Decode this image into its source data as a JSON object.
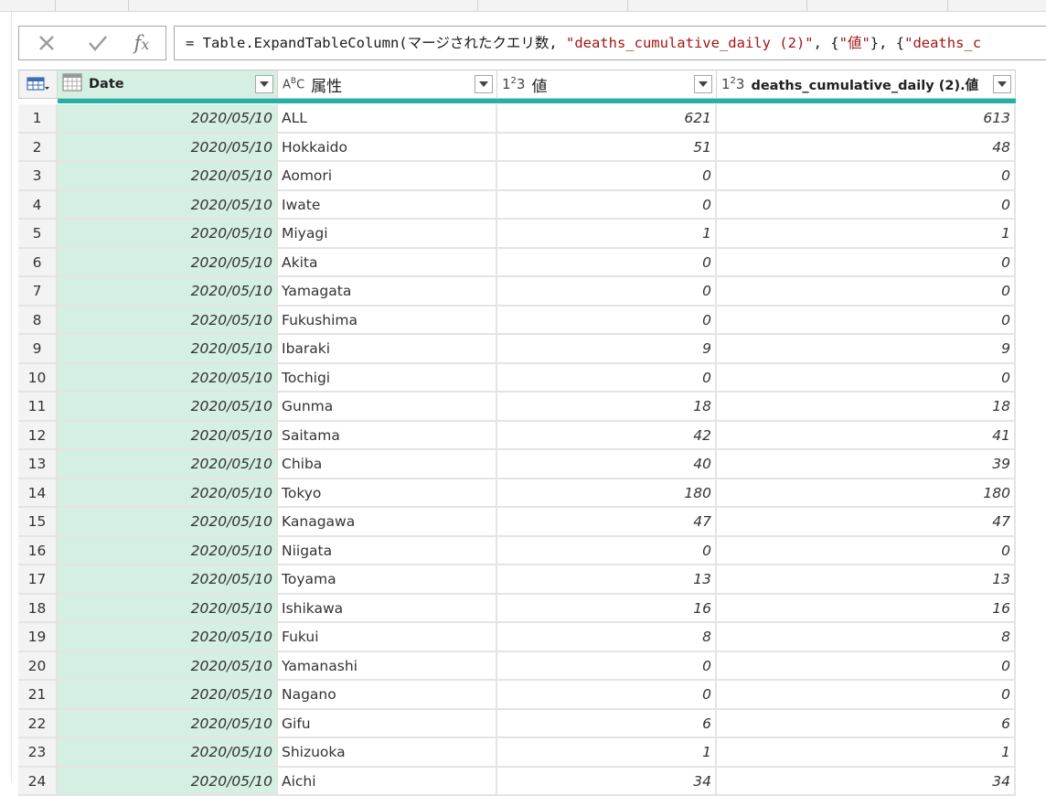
{
  "formula": {
    "prefix": "= Table.ExpandTableColumn(マージされたクエリ数, ",
    "arg1": "\"deaths_cumulative_daily (2)\"",
    "mid": ", {",
    "arg2": "\"値\"",
    "mid2": "}, {",
    "arg3": "\"deaths_c"
  },
  "columns": [
    {
      "type_icon": "calendar-icon",
      "label": "Date"
    },
    {
      "type_icon": "ABC",
      "label": "属性"
    },
    {
      "type_icon": "123",
      "label": "値"
    },
    {
      "type_icon": "123",
      "label": "deaths_cumulative_daily (2).値"
    }
  ],
  "rows": [
    {
      "i": "1",
      "date": "2020/05/10",
      "attr": "ALL",
      "val": "621",
      "cum": "613"
    },
    {
      "i": "2",
      "date": "2020/05/10",
      "attr": "Hokkaido",
      "val": "51",
      "cum": "48"
    },
    {
      "i": "3",
      "date": "2020/05/10",
      "attr": "Aomori",
      "val": "0",
      "cum": "0"
    },
    {
      "i": "4",
      "date": "2020/05/10",
      "attr": "Iwate",
      "val": "0",
      "cum": "0"
    },
    {
      "i": "5",
      "date": "2020/05/10",
      "attr": "Miyagi",
      "val": "1",
      "cum": "1"
    },
    {
      "i": "6",
      "date": "2020/05/10",
      "attr": "Akita",
      "val": "0",
      "cum": "0"
    },
    {
      "i": "7",
      "date": "2020/05/10",
      "attr": "Yamagata",
      "val": "0",
      "cum": "0"
    },
    {
      "i": "8",
      "date": "2020/05/10",
      "attr": "Fukushima",
      "val": "0",
      "cum": "0"
    },
    {
      "i": "9",
      "date": "2020/05/10",
      "attr": "Ibaraki",
      "val": "9",
      "cum": "9"
    },
    {
      "i": "10",
      "date": "2020/05/10",
      "attr": "Tochigi",
      "val": "0",
      "cum": "0"
    },
    {
      "i": "11",
      "date": "2020/05/10",
      "attr": "Gunma",
      "val": "18",
      "cum": "18"
    },
    {
      "i": "12",
      "date": "2020/05/10",
      "attr": "Saitama",
      "val": "42",
      "cum": "41"
    },
    {
      "i": "13",
      "date": "2020/05/10",
      "attr": "Chiba",
      "val": "40",
      "cum": "39"
    },
    {
      "i": "14",
      "date": "2020/05/10",
      "attr": "Tokyo",
      "val": "180",
      "cum": "180"
    },
    {
      "i": "15",
      "date": "2020/05/10",
      "attr": "Kanagawa",
      "val": "47",
      "cum": "47"
    },
    {
      "i": "16",
      "date": "2020/05/10",
      "attr": "Niigata",
      "val": "0",
      "cum": "0"
    },
    {
      "i": "17",
      "date": "2020/05/10",
      "attr": "Toyama",
      "val": "13",
      "cum": "13"
    },
    {
      "i": "18",
      "date": "2020/05/10",
      "attr": "Ishikawa",
      "val": "16",
      "cum": "16"
    },
    {
      "i": "19",
      "date": "2020/05/10",
      "attr": "Fukui",
      "val": "8",
      "cum": "8"
    },
    {
      "i": "20",
      "date": "2020/05/10",
      "attr": "Yamanashi",
      "val": "0",
      "cum": "0"
    },
    {
      "i": "21",
      "date": "2020/05/10",
      "attr": "Nagano",
      "val": "0",
      "cum": "0"
    },
    {
      "i": "22",
      "date": "2020/05/10",
      "attr": "Gifu",
      "val": "6",
      "cum": "6"
    },
    {
      "i": "23",
      "date": "2020/05/10",
      "attr": "Shizuoka",
      "val": "1",
      "cum": "1"
    },
    {
      "i": "24",
      "date": "2020/05/10",
      "attr": "Aichi",
      "val": "34",
      "cum": "34"
    }
  ],
  "colors": {
    "accent": "#1fb3a6",
    "selected_column": "#d6efe3",
    "string_literal": "#a31515"
  }
}
